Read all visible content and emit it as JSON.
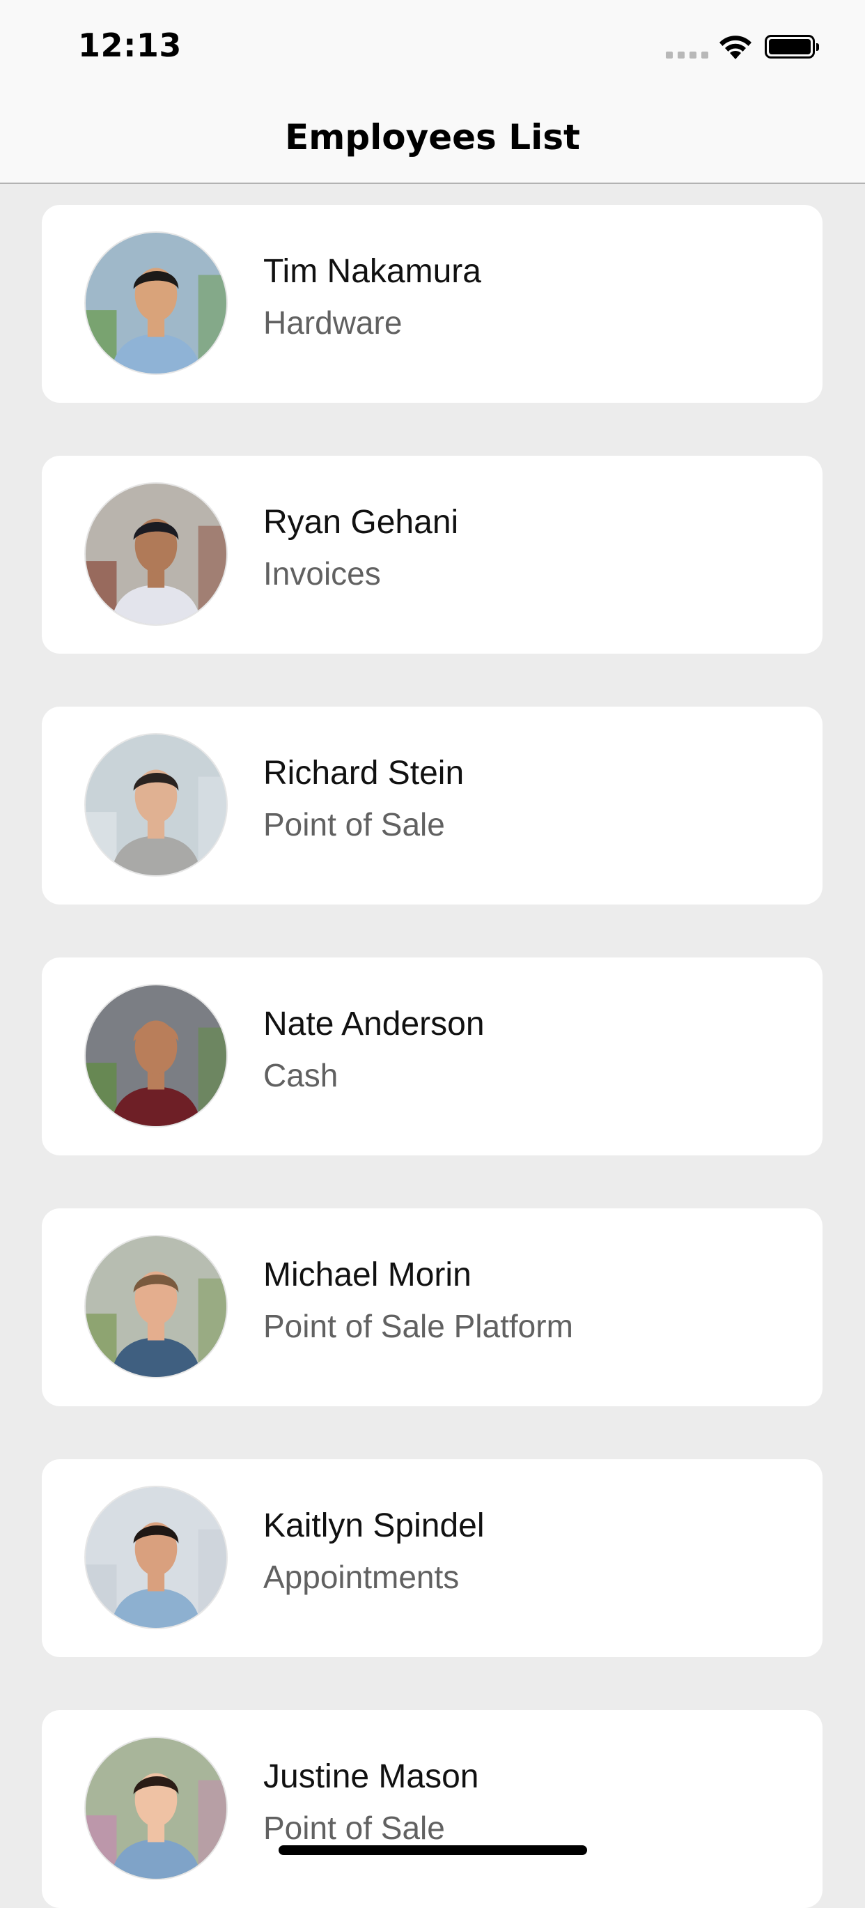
{
  "status_bar": {
    "time": "12:13",
    "icons": [
      "cellular-signal-icon",
      "wifi-icon",
      "battery-icon"
    ]
  },
  "nav": {
    "title": "Employees List"
  },
  "employees": [
    {
      "name": "Tim Nakamura",
      "team": "Hardware",
      "avatar": {
        "bg": "#9fb8c9",
        "skin": "#d9a37a",
        "hair": "#1d1a18",
        "shirt": "#8fb3d6",
        "accent": "#6a9a4a"
      }
    },
    {
      "name": "Ryan Gehani",
      "team": "Invoices",
      "avatar": {
        "bg": "#b9b4ad",
        "skin": "#b07a58",
        "hair": "#1b1b22",
        "shirt": "#e3e4ec",
        "accent": "#8a4a3a"
      }
    },
    {
      "name": "Richard Stein",
      "team": "Point of Sale",
      "avatar": {
        "bg": "#c9d3d8",
        "skin": "#e0b192",
        "hair": "#2a2320",
        "shirt": "#a9a9a7",
        "accent": "#dfe6ea"
      }
    },
    {
      "name": "Nate Anderson",
      "team": "Cash",
      "avatar": {
        "bg": "#7b7e84",
        "skin": "#b97e5a",
        "hair": "#b97e5a",
        "shirt": "#6e1f26",
        "accent": "#5f8d3e"
      }
    },
    {
      "name": "Michael Morin",
      "team": "Point of Sale Platform",
      "avatar": {
        "bg": "#b7bdb1",
        "skin": "#e4ae8e",
        "hair": "#7a5a3e",
        "shirt": "#3f5f80",
        "accent": "#7c9a55"
      }
    },
    {
      "name": "Kaitlyn Spindel",
      "team": "Appointments",
      "avatar": {
        "bg": "#d7dde3",
        "skin": "#d9a07e",
        "hair": "#1e1714",
        "shirt": "#8db0d0",
        "accent": "#c7ced6"
      }
    },
    {
      "name": "Justine Mason",
      "team": "Point of Sale",
      "avatar": {
        "bg": "#a8b59a",
        "skin": "#efc2a4",
        "hair": "#2a1c16",
        "shirt": "#7fa3c8",
        "accent": "#c58ab0"
      }
    }
  ]
}
